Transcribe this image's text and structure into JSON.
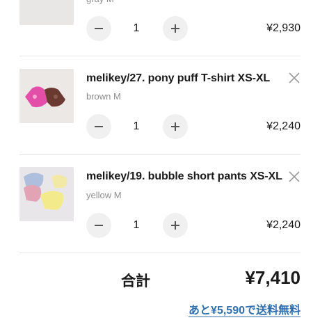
{
  "colors": {
    "accent": "#2f6fb0",
    "divider": "#e6e6e6",
    "muted": "#8e8e8e",
    "button_bg": "#f0f0f0"
  },
  "cart": {
    "items": [
      {
        "title": "",
        "variant": "gray M",
        "quantity": "1",
        "price": "¥2,930"
      },
      {
        "title": "melikey/27. pony puff T-shirt XS-XL",
        "variant": "brown M",
        "quantity": "1",
        "price": "¥2,240"
      },
      {
        "title": "melikey/19. bubble short pants XS-XL",
        "variant": "yellow M",
        "quantity": "1",
        "price": "¥2,240"
      }
    ]
  },
  "summary": {
    "total_label": "合計",
    "total_value": "¥7,410",
    "free_shipping_note": "あと¥5,590で送料無料"
  },
  "icons": {
    "decrease": "minus-icon",
    "increase": "plus-icon",
    "remove": "close-icon"
  }
}
